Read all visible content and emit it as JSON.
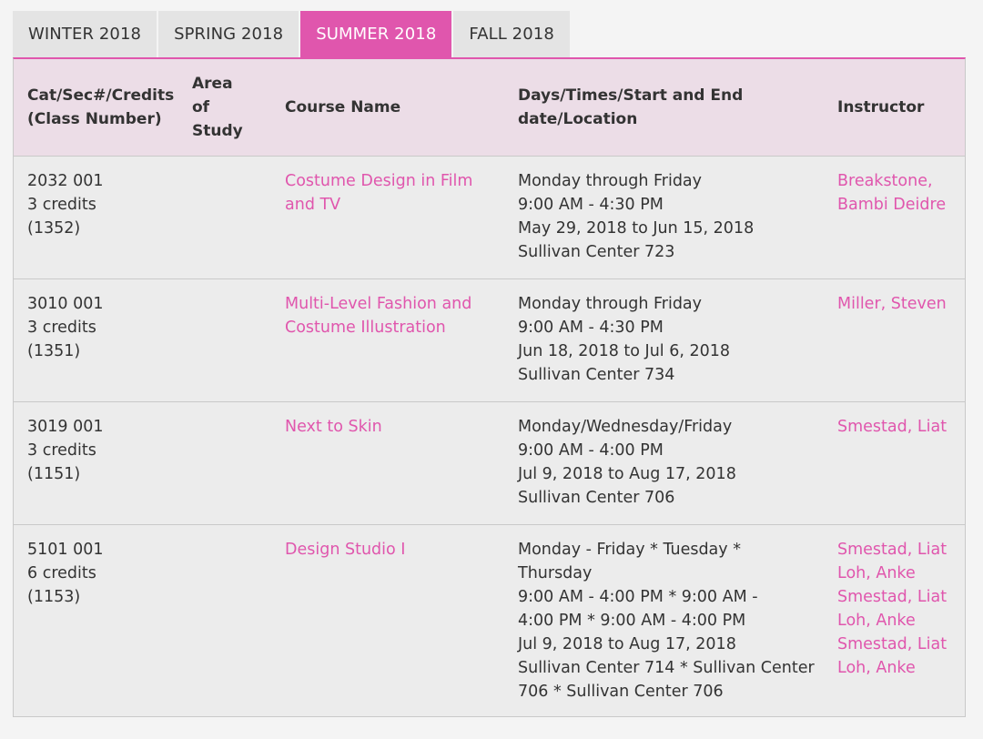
{
  "tabs": [
    "WINTER 2018",
    "SPRING 2018",
    "SUMMER 2018",
    "FALL 2018"
  ],
  "active_tab": "SUMMER 2018",
  "colors": {
    "accent": "#e056ad",
    "header_bg": "#ecdde7",
    "row_bg": "#ececec"
  },
  "table": {
    "headers": {
      "cat": [
        "Cat/Sec#/Credits",
        "(Class Number)"
      ],
      "area": [
        "Area",
        "of",
        "Study"
      ],
      "course": "Course Name",
      "days": [
        "Days/Times/Start and End",
        "date/Location"
      ],
      "instructor": "Instructor"
    },
    "rows": [
      {
        "cat": [
          "2032 001",
          "3 credits",
          "(1352)"
        ],
        "area": "",
        "course": [
          "Costume Design in Film",
          "and TV"
        ],
        "days": [
          "Monday through Friday",
          "9:00 AM - 4:30 PM",
          "May 29, 2018 to Jun 15, 2018",
          "Sullivan Center 723"
        ],
        "instructor": [
          "Breakstone,",
          "Bambi Deidre"
        ]
      },
      {
        "cat": [
          "3010 001",
          "3 credits",
          "(1351)"
        ],
        "area": "",
        "course": [
          "Multi-Level Fashion and",
          "Costume Illustration"
        ],
        "days": [
          "Monday through Friday",
          "9:00 AM - 4:30 PM",
          "Jun 18, 2018 to Jul 6, 2018",
          "Sullivan Center 734"
        ],
        "instructor": [
          "Miller, Steven"
        ]
      },
      {
        "cat": [
          "3019 001",
          "3 credits",
          "(1151)"
        ],
        "area": "",
        "course": [
          "Next to Skin"
        ],
        "days": [
          "Monday/Wednesday/Friday",
          "9:00 AM - 4:00 PM",
          "Jul 9, 2018 to Aug 17, 2018",
          "Sullivan Center 706"
        ],
        "instructor": [
          "Smestad, Liat"
        ]
      },
      {
        "cat": [
          "5101 001",
          "6 credits",
          "(1153)"
        ],
        "area": "",
        "course": [
          "Design Studio I"
        ],
        "days": [
          "Monday - Friday * Tuesday *",
          "Thursday",
          "9:00 AM - 4:00 PM * 9:00 AM -",
          "4:00 PM * 9:00 AM - 4:00 PM",
          "Jul 9, 2018 to Aug 17, 2018",
          "Sullivan Center 714 * Sullivan Center",
          "706 * Sullivan Center 706"
        ],
        "instructor": [
          "Smestad, Liat",
          "Loh, Anke",
          "Smestad, Liat",
          "Loh, Anke",
          "Smestad, Liat",
          "Loh, Anke"
        ]
      }
    ]
  }
}
